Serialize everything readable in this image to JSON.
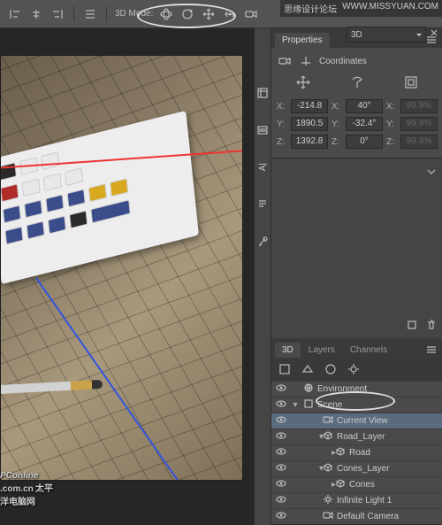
{
  "watermark": {
    "left": "思缘设计论坛",
    "right": "WWW.MISSYUAN.COM"
  },
  "topbar": {
    "mode_label": "3D Mode:",
    "dropdown": "3D"
  },
  "vstrip": {
    "label1": "A|"
  },
  "properties": {
    "tab": "Properties",
    "section": "Coordinates",
    "rows": [
      {
        "axis": "X:",
        "pos": "-214.8",
        "axis2": "X:",
        "rot": "40°",
        "scale_axis": "X:",
        "scale": "99.9%"
      },
      {
        "axis": "Y:",
        "pos": "1890.5",
        "axis2": "Y:",
        "rot": "-32.4°",
        "scale_axis": "Y:",
        "scale": "99.9%"
      },
      {
        "axis": "Z:",
        "pos": "1392.8",
        "axis2": "Z:",
        "rot": "0°",
        "scale_axis": "Z:",
        "scale": "99.9%"
      }
    ]
  },
  "panel3d": {
    "tabs": {
      "t1": "3D",
      "t2": "Layers",
      "t3": "Channels"
    },
    "tree": [
      {
        "name": "Environment",
        "depth": 0,
        "eye": true,
        "twisty": "",
        "icon": "env"
      },
      {
        "name": "Scene",
        "depth": 0,
        "eye": true,
        "twisty": "▾",
        "icon": "scene"
      },
      {
        "name": "Current View",
        "depth": 1,
        "eye": true,
        "twisty": "",
        "icon": "camera",
        "selected": true
      },
      {
        "name": "Road_Layer",
        "depth": 1,
        "eye": true,
        "twisty": "▾",
        "icon": "mesh"
      },
      {
        "name": "Road",
        "depth": 2,
        "eye": true,
        "twisty": "▸",
        "icon": "mesh"
      },
      {
        "name": "Cones_Layer",
        "depth": 1,
        "eye": true,
        "twisty": "▾",
        "icon": "mesh"
      },
      {
        "name": "Cones",
        "depth": 2,
        "eye": true,
        "twisty": "▸",
        "icon": "mesh"
      },
      {
        "name": "Infinite Light 1",
        "depth": 1,
        "eye": true,
        "twisty": "",
        "icon": "light"
      },
      {
        "name": "Default Camera",
        "depth": 1,
        "eye": true,
        "twisty": "",
        "icon": "camera"
      }
    ]
  },
  "branding": {
    "logo": "PConline",
    "sub": ".com.cn",
    "cn": "太平洋电脑网"
  }
}
